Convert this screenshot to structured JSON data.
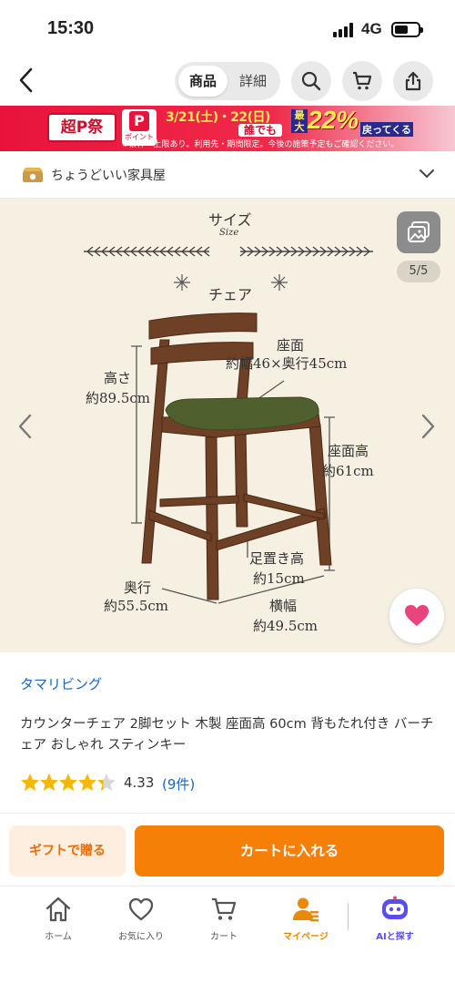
{
  "status_bar": {
    "time": "15:30",
    "network": "4G"
  },
  "nav": {
    "segments": [
      "商品",
      "詳細"
    ],
    "active_segment": "商品"
  },
  "banner": {
    "event_logo": "超P祭",
    "point_logo": "P",
    "point_label": "ポイント",
    "dates": "3/21(土)・22(日)",
    "audience": "誰でも",
    "max_label": "最大",
    "percent": "22%",
    "return_text": "戻ってくる",
    "note": "※条件・上限あり。利用先・期間限定。今後の施策予定もご確認ください。"
  },
  "shop": {
    "name": "ちょうどいい家具屋"
  },
  "gallery": {
    "counter": "5/5",
    "heading": "サイズ",
    "heading_en": "Size",
    "subheading": "チェア",
    "dims": {
      "height_label": "高さ",
      "height_value": "約89.5cm",
      "seat_label": "座面",
      "seat_value": "約幅46×奥行45cm",
      "seat_height_label": "座面高",
      "seat_height_value": "約61cm",
      "foot_label": "足置き高",
      "foot_value": "約15cm",
      "depth_label": "奥行",
      "depth_value": "約55.5cm",
      "width_label": "横幅",
      "width_value": "約49.5cm"
    }
  },
  "product": {
    "brand": "タマリビング",
    "title": "カウンターチェア 2脚セット 木製 座面高 60cm 背もたれ付き バーチェア おしゃれ スティンキー",
    "rating": 4.33,
    "rating_text": "4.33",
    "review_count": "(9件)"
  },
  "actions": {
    "gift": "ギフトで贈る",
    "cart": "カートに入れる"
  },
  "tabbar": {
    "items": [
      {
        "label": "ホーム",
        "icon": "home-icon"
      },
      {
        "label": "お気に入り",
        "icon": "heart-outline-icon"
      },
      {
        "label": "カート",
        "icon": "cart-icon"
      },
      {
        "label": "マイページ",
        "icon": "person-icon"
      },
      {
        "label": "AIと探す",
        "icon": "ai-robot-icon"
      }
    ],
    "active": "マイページ"
  },
  "colors": {
    "accent_orange": "#f67f07",
    "banner_red": "#e8133b",
    "link_blue": "#1a66c8",
    "star_yellow": "#f5b800",
    "favorite_pink": "#e8457f",
    "image_bg": "#f6f0e3",
    "chair_wood": "#6e4026",
    "chair_seat": "#4f5f2e"
  }
}
